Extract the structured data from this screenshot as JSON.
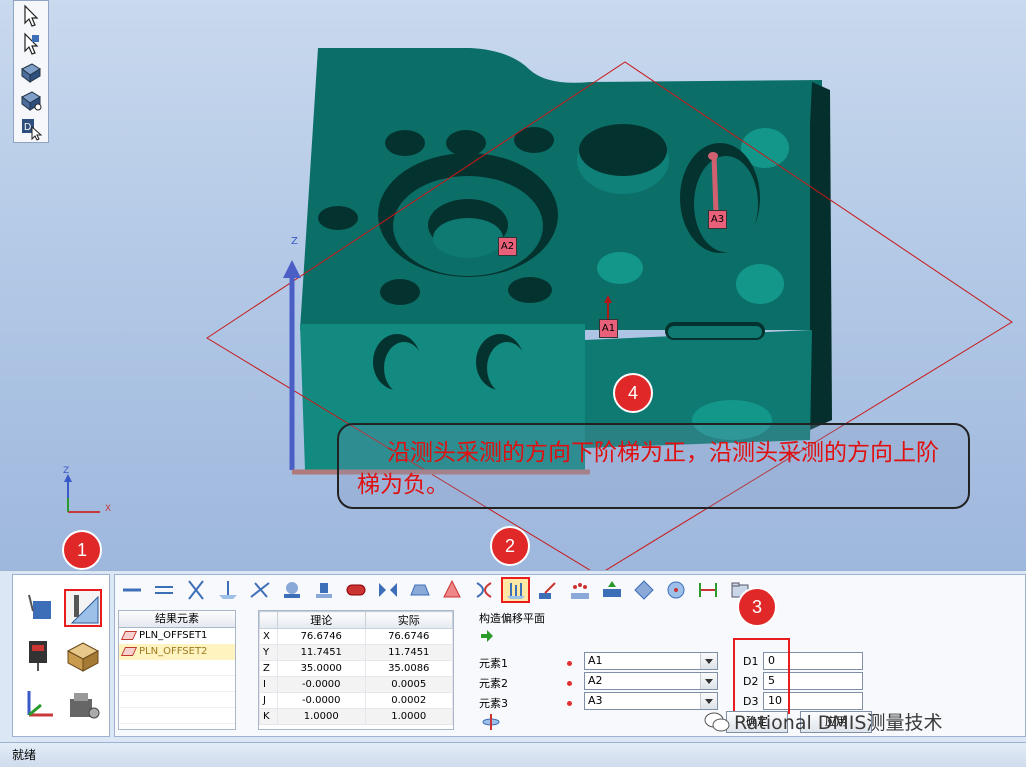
{
  "viewport": {
    "labels": {
      "a1": "A1",
      "a2": "A2",
      "a3": "A3",
      "axis_z": "Z",
      "axis_x": "X",
      "triad_z": "Z"
    }
  },
  "left_toolbar": {
    "items": [
      "select-arrow-icon",
      "select-probe-icon",
      "view-part-icon",
      "view-rotate-icon",
      "probe-d-icon"
    ]
  },
  "annotations": {
    "badge1": "1",
    "badge2": "2",
    "badge3": "3",
    "badge4": "4",
    "callout_text": "沿测头采测的方向下阶梯为正，沿测头采测的方向上阶梯为负。"
  },
  "mode_buttons": [
    "probe-mode-icon",
    "construct-mode-icon",
    "probe-tip-icon",
    "report-icon",
    "coordinate-system-icon",
    "tool-settings-icon"
  ],
  "construct_toolbar": {
    "icons": [
      "line-icon",
      "parallel-lines-icon",
      "intersect-icon",
      "point-on-plane-icon",
      "angle-icon",
      "sphere-point-icon",
      "cylinder-point-icon",
      "slot-icon",
      "symmetry-icon",
      "trapezoid-icon",
      "cone-icon",
      "curve-icon",
      "offset-plane-icon",
      "transform-icon",
      "pattern-icon",
      "project-icon",
      "rotate-icon",
      "circle-icon",
      "width-icon",
      "folder-icon"
    ]
  },
  "result_list": {
    "header": "结果元素",
    "items": [
      {
        "label": "PLN_OFFSET1",
        "selected": false
      },
      {
        "label": "PLN_OFFSET2",
        "selected": true
      }
    ]
  },
  "coord_table": {
    "headers": [
      "",
      "理论",
      "实际"
    ],
    "rows": [
      {
        "axis": "X",
        "nominal": "76.6746",
        "actual": "76.6746"
      },
      {
        "axis": "Y",
        "nominal": "11.7451",
        "actual": "11.7451"
      },
      {
        "axis": "Z",
        "nominal": "35.0000",
        "actual": "35.0086"
      },
      {
        "axis": "I",
        "nominal": "-0.0000",
        "actual": "0.0005"
      },
      {
        "axis": "J",
        "nominal": "-0.0000",
        "actual": "0.0002"
      },
      {
        "axis": "K",
        "nominal": "1.0000",
        "actual": "1.0000"
      }
    ]
  },
  "form": {
    "title": "构造偏移平面",
    "element1_label": "元素1",
    "element1_value": "A1",
    "element2_label": "元素2",
    "element2_value": "A2",
    "element3_label": "元素3",
    "element3_value": "A3",
    "d1_label": "D1",
    "d1_value": "0",
    "d2_label": "D2",
    "d2_value": "5",
    "d3_label": "D3",
    "d3_value": "10",
    "ok_label": "确定",
    "apply_label": "应用"
  },
  "watermark": "Rational DMIS测量技术",
  "status": "就绪",
  "colors": {
    "part": "#0b6f68",
    "part_light": "#138a80",
    "highlight": "#e81c1c",
    "callout_text": "#e01010"
  }
}
